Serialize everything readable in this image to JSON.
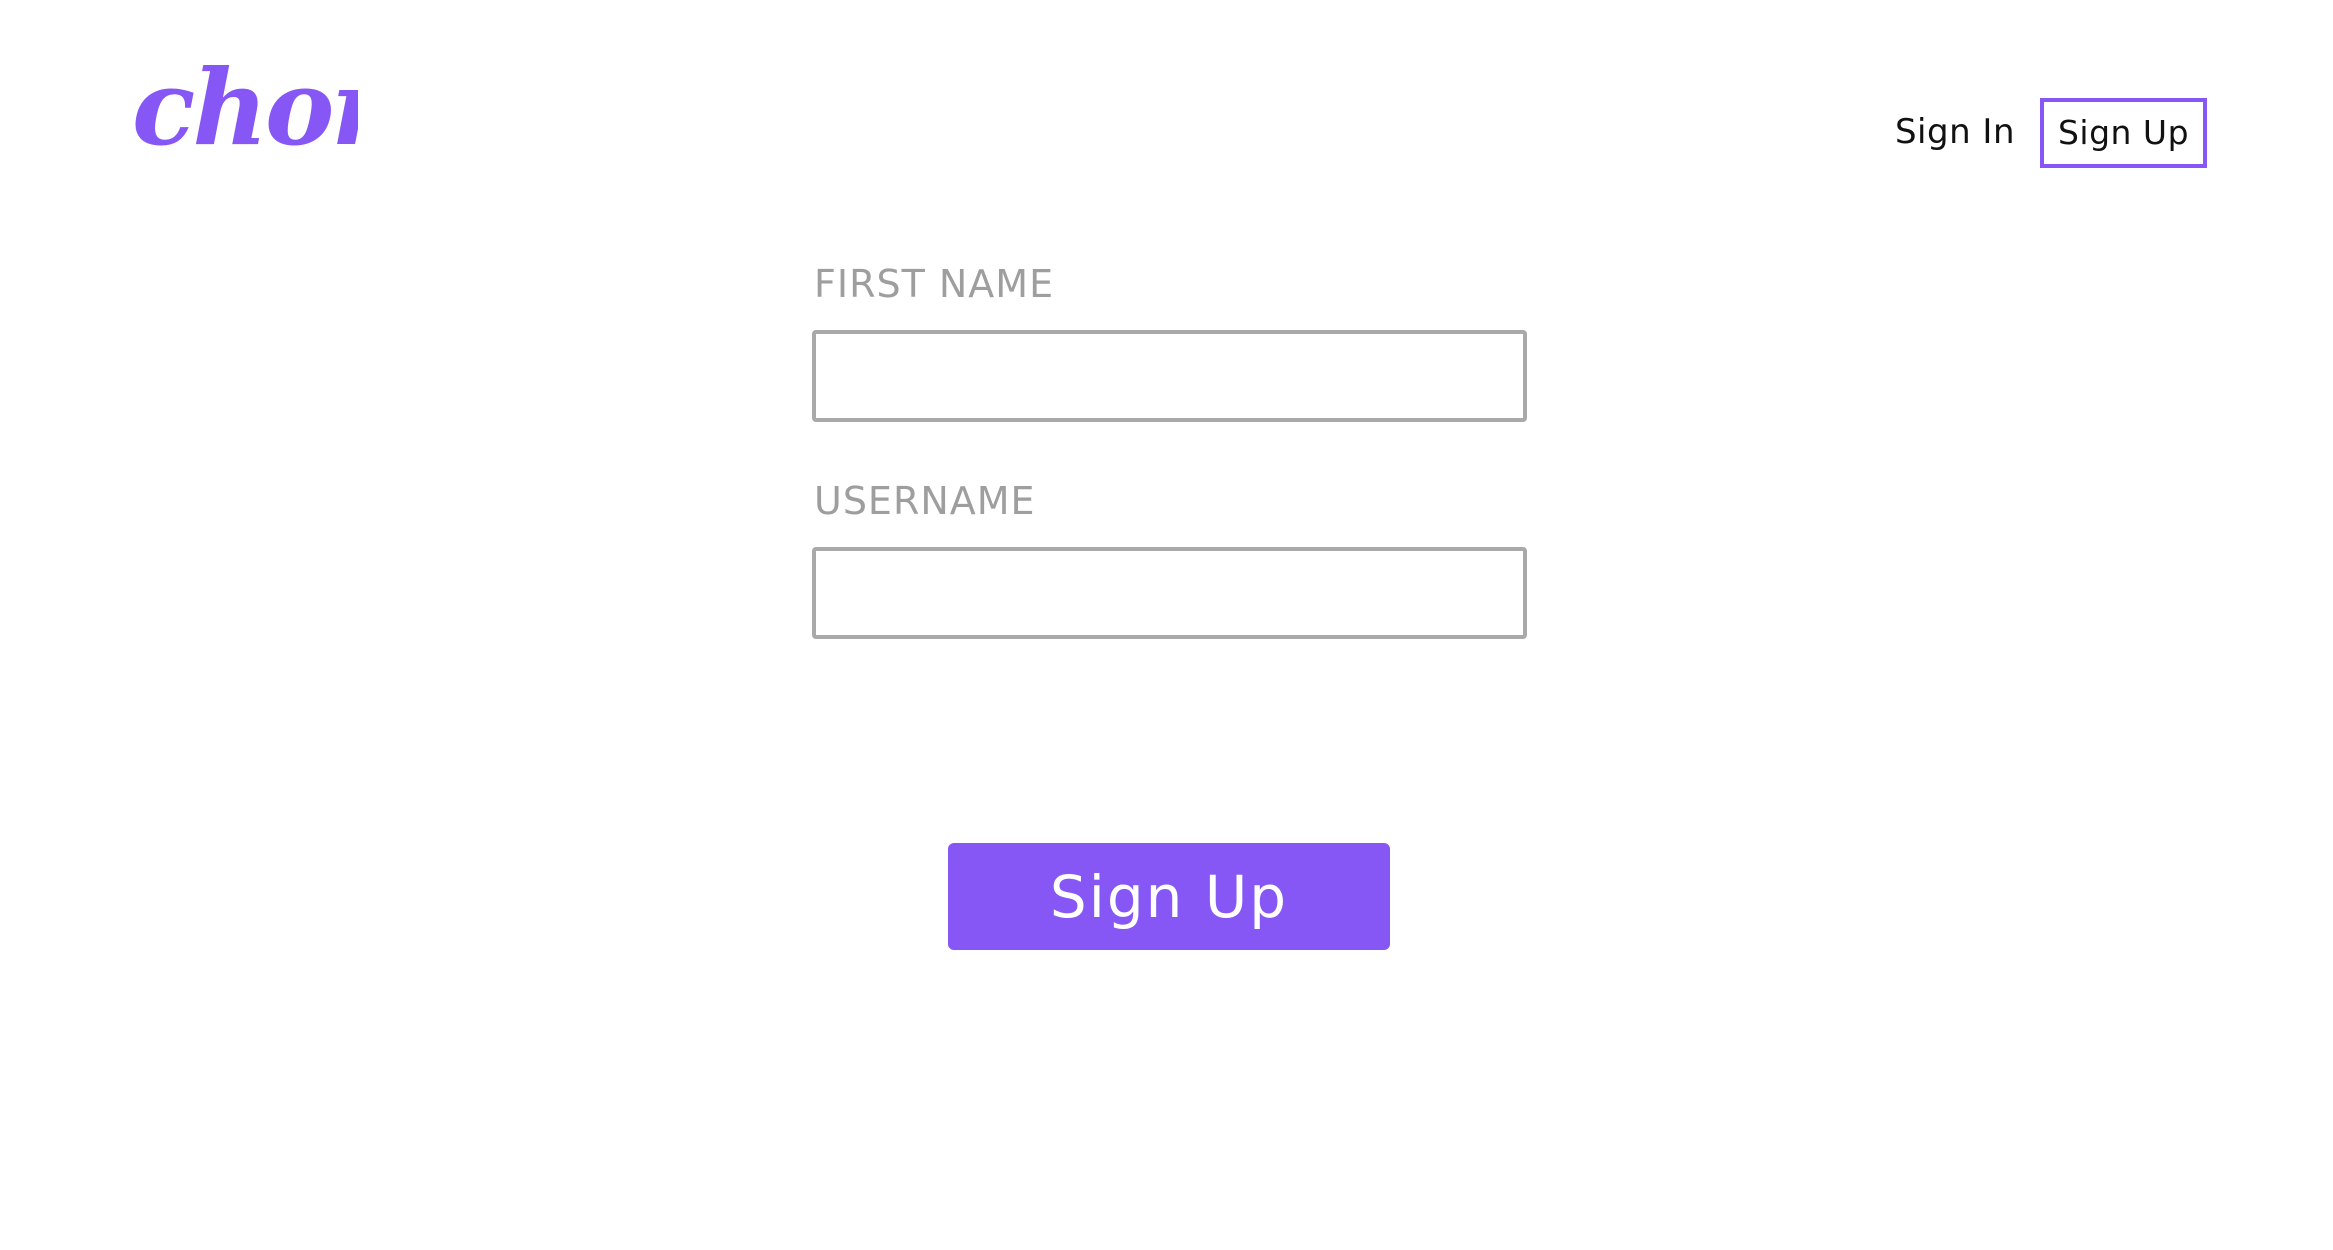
{
  "brand": {
    "logo_text": "chorus",
    "accent_color": "#8657f5"
  },
  "nav": {
    "sign_in_label": "Sign In",
    "sign_up_label": "Sign Up"
  },
  "form": {
    "first_name": {
      "label": "FIRST NAME",
      "value": "",
      "placeholder": ""
    },
    "username": {
      "label": "USERNAME",
      "value": "",
      "placeholder": ""
    },
    "submit_label": "Sign Up"
  }
}
